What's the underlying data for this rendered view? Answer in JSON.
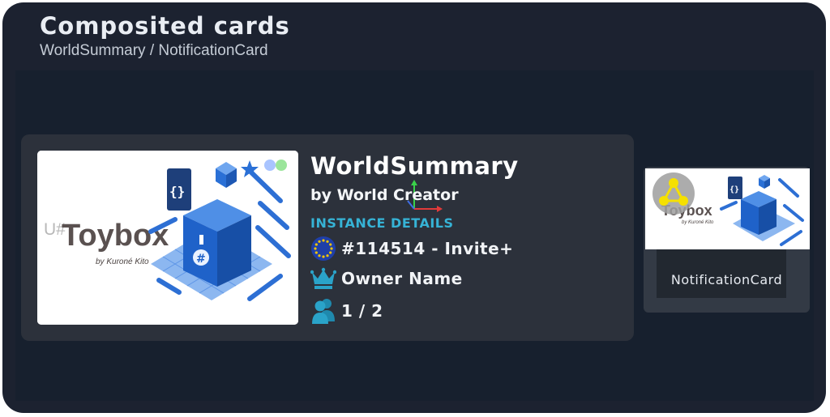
{
  "header": {
    "title": "Composited cards",
    "subtitle": "WorldSummary / NotificationCard"
  },
  "world_summary": {
    "title": "WorldSummary",
    "creator": "by World Creator",
    "section_label": "INSTANCE DETAILS",
    "instance": "#114514 - Invite+",
    "owner": "Owner Name",
    "users": "1 / 2",
    "thumbnail": {
      "prefix": "U#",
      "name": "Toybox",
      "byline": "by Kuroné Kito"
    }
  },
  "notification_card": {
    "label": "NotificationCard",
    "thumbnail": {
      "name": "Toybox",
      "byline": "by Kuroné Kito"
    }
  },
  "colors": {
    "window_bg": "#1c2230",
    "viewport_bg": "#17202e",
    "card_bg": "#2c313b",
    "section_accent": "#36b3d6",
    "icon_teal": "#2aa3c9",
    "flag_blue": "#1f3fa8",
    "flag_star": "#f2c400"
  },
  "icons": {
    "region": "eu-flag-icon",
    "owner": "crown-icon",
    "users": "users-icon",
    "gizmo": "transform-gizmo-icon",
    "avatar": "network-avatar-icon"
  }
}
